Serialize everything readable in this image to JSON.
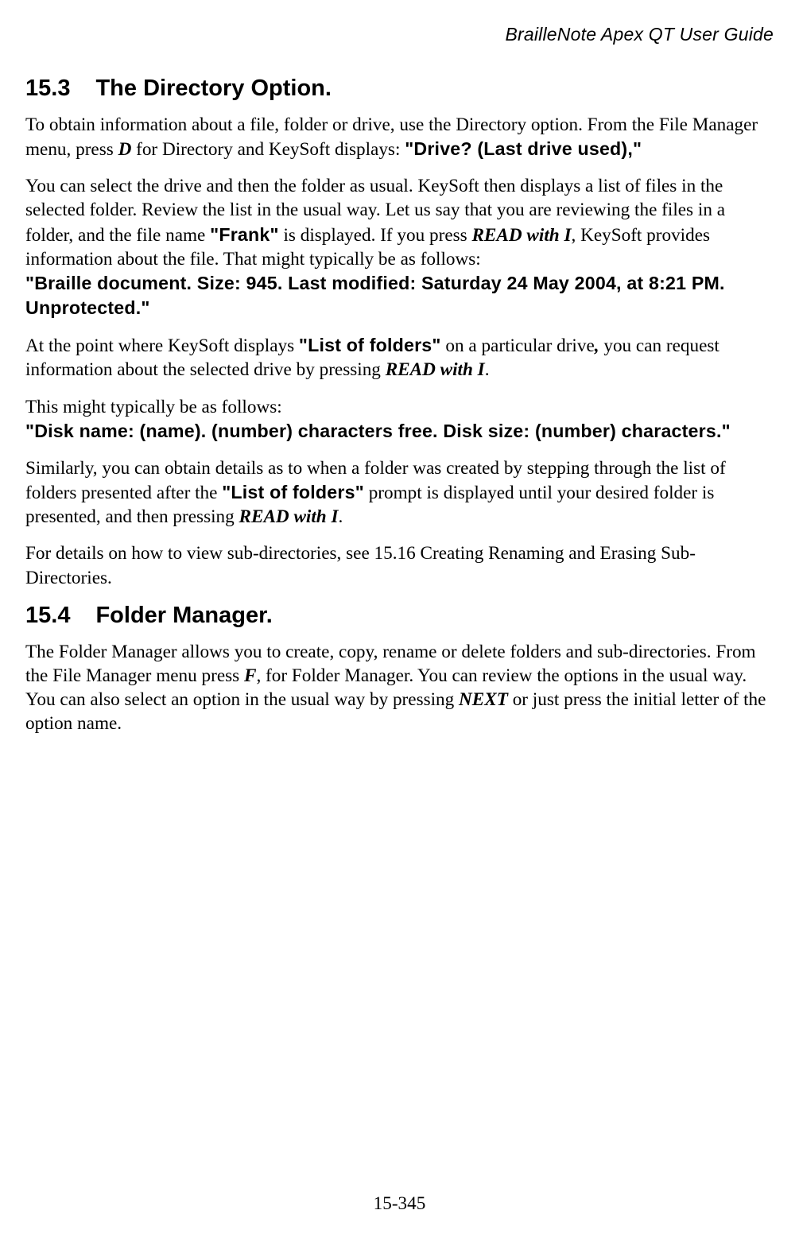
{
  "header": "BrailleNote Apex QT User Guide",
  "s153": {
    "num": "15.3",
    "title": "The Directory Option.",
    "p1_a": "To obtain information about a file, folder or drive, use the Directory option. From the File Manager menu, press ",
    "p1_D": "D",
    "p1_b": " for Directory and KeySoft displays: ",
    "p1_ks1": "\"Drive? (Last drive used),\"",
    "p2_a": "You can select the drive and then the folder as usual. KeySoft then displays a list of files in the selected folder. Review the list in the usual way. Let us say that you are reviewing the files in a folder, and the file name ",
    "p2_ks_frank": "\"Frank\"",
    "p2_b": " is displayed. If you press ",
    "p2_readI": "READ with I",
    "p2_c": ", KeySoft provides information about the file. That might typically be as follows:",
    "p2_ks_block": "\"Braille document. Size: 945. Last modified: Saturday 24 May 2004, at 8:21 PM. Unprotected.\"",
    "p3_a": "At the point where KeySoft displays ",
    "p3_ks_list": "\"List of folders\"",
    "p3_b": " on a particular drive",
    "p3_comma": ",",
    "p3_c": " you can request information about the selected drive by pressing ",
    "p3_readI": "READ with I",
    "p3_d": ".",
    "p4_a": "This might typically be as follows:",
    "p4_ks_disk": "\"Disk name: (name). (number) characters free. Disk size: (number) characters.\"",
    "p5_a": "Similarly, you can obtain details as to when a folder was created by stepping through the list of folders presented after the ",
    "p5_ks_list": "\"List of folders\"",
    "p5_b": " prompt is displayed until your desired folder is presented, and then pressing ",
    "p5_readI": "READ with I",
    "p5_c": ".",
    "p6": "For details on how to view sub-directories, see 15.16 Creating Renaming and Erasing Sub-Directories."
  },
  "s154": {
    "num": "15.4",
    "title": "Folder Manager.",
    "p1_a": "The Folder Manager allows you to create, copy, rename or delete folders and sub-directories. From the File Manager menu press ",
    "p1_F": "F",
    "p1_b": ", for Folder Manager. You can review the options in the usual way. You can also select an option in the usual way by pressing ",
    "p1_next": "NEXT",
    "p1_c": " or just press the initial letter of the option name."
  },
  "footer": "15-345"
}
